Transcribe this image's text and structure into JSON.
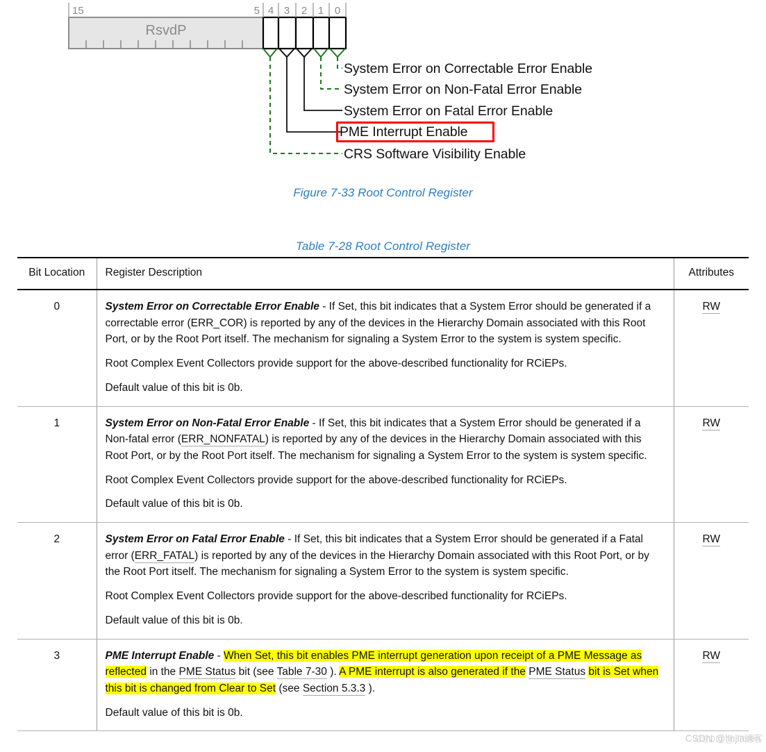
{
  "figure": {
    "bitfield": {
      "reserved_field": {
        "label": "RsvdP",
        "high_bit": "15",
        "low_bit": "5",
        "tick_count": 10
      },
      "bits": [
        {
          "number": "4",
          "leader_style": "green-dashed"
        },
        {
          "number": "3",
          "leader_style": "black-solid"
        },
        {
          "number": "2",
          "leader_style": "black-solid"
        },
        {
          "number": "1",
          "leader_style": "green-dashed"
        },
        {
          "number": "0",
          "leader_style": "green-dashed"
        }
      ]
    },
    "callouts": {
      "correctable": "System Error on Correctable Error Enable",
      "nonfatal": "System Error on Non-Fatal Error Enable",
      "fatal": "System Error on Fatal Error Enable",
      "pme": "PME Interrupt Enable",
      "crs": "CRS Software Visibility Enable"
    },
    "highlight_color": "#ff0000",
    "caption": "Figure  7-33  Root Control Register"
  },
  "table": {
    "caption": "Table  7-28  Root Control Register",
    "headers": {
      "bit": "Bit Location",
      "description": "Register Description",
      "attributes": "Attributes"
    },
    "rows": [
      {
        "bit": "0",
        "attribute": "RW",
        "term": "System Error on Correctable Error Enable",
        "p1_a": " - If Set, this bit indicates that a System Error should be generated if a correctable error (ERR_COR) is reported by any of the devices in the Hierarchy Domain associated with this Root Port, or by the Root Port itself. The mechanism for signaling a System Error to the system is system specific.",
        "p2": "Root Complex Event Collectors provide support for the above-described functionality for RCiEPs.",
        "p3": "Default value of this bit is 0b."
      },
      {
        "bit": "1",
        "attribute": "RW",
        "term": "System Error on Non-Fatal Error Enable",
        "p1_a": " - If Set, this bit indicates that a System Error should be generated if a Non-fatal error (",
        "p1_xref": "ERR_NONFATAL",
        "p1_b": ") is reported by any of the devices in the Hierarchy Domain associated with this Root Port, or by the Root Port itself. The mechanism for signaling a System Error to the system is system specific.",
        "p2": "Root Complex Event Collectors provide support for the above-described functionality for RCiEPs.",
        "p3": "Default value of this bit is 0b."
      },
      {
        "bit": "2",
        "attribute": "RW",
        "term": "System Error on Fatal Error Enable",
        "p1_a": " - If Set, this bit indicates that a System Error should be generated if a Fatal error (",
        "p1_xref": "ERR_FATAL",
        "p1_b": ") is reported by any of the devices in the Hierarchy Domain associated with this Root Port, or by the Root Port itself. The mechanism for signaling a System Error to the system is system specific.",
        "p2": "Root Complex Event Collectors provide support for the above-described functionality for RCiEPs.",
        "p3": "Default value of this bit is 0b."
      },
      {
        "bit": "3",
        "attribute": "RW",
        "term": "PME Interrupt Enable",
        "p1_dash": " - ",
        "p1_hl1": "When Set, this bit enables PME interrupt generation upon receipt of a PME Message as reflected",
        "p1_mid1": " in the ",
        "p1_xref1": "PME Status",
        "p1_mid2": " bit (see ",
        "p1_xref2": "Table  7-30",
        "p1_mid3": " ). ",
        "p1_hl2": "A PME interrupt is also generated if the",
        "p1_mid4": " ",
        "p1_xref3": "PME Status",
        "p1_mid5": " ",
        "p1_hl3": "bit is Set when this bit is changed from Clear to Set",
        "p1_mid6": " (see ",
        "p1_xref4": "Section 5.3.3",
        "p1_mid7": " ).",
        "p3": "Default value of this bit is 0b."
      }
    ]
  },
  "watermark": {
    "text": "CSDN @linjiasen",
    "under_text": "CSDN @IT博客"
  }
}
